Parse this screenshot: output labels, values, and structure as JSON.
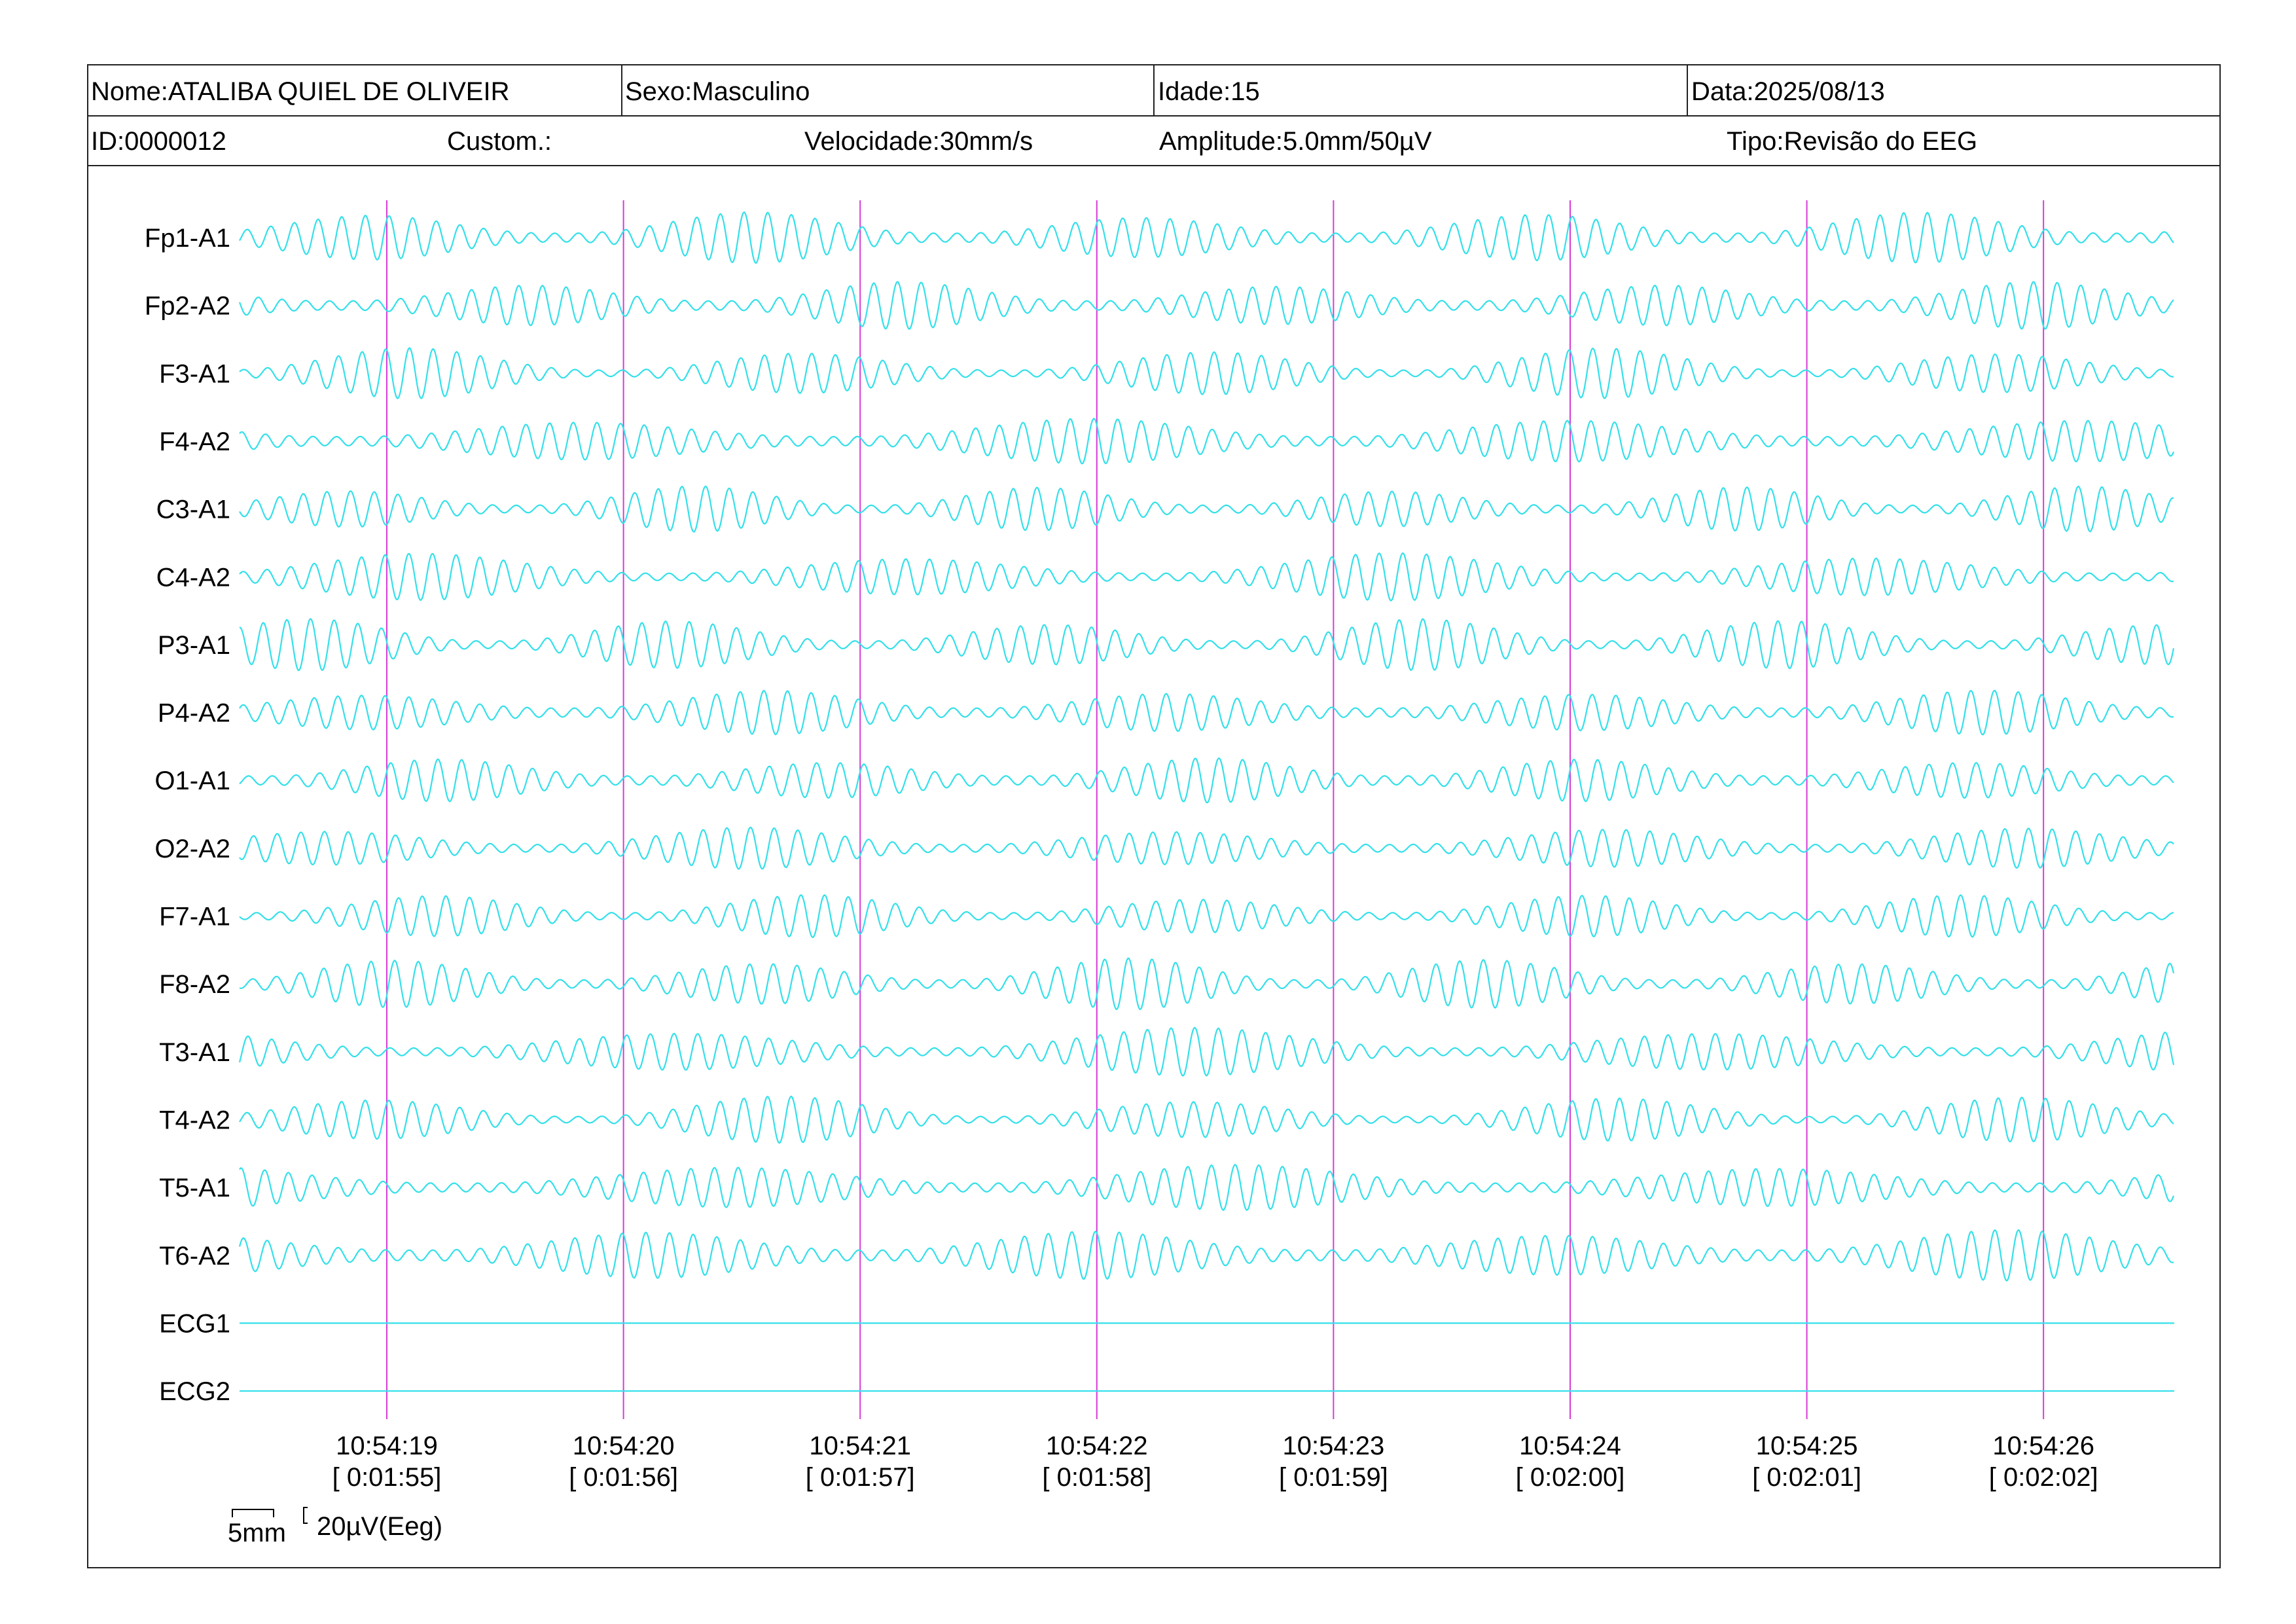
{
  "header": {
    "nome": "Nome:ATALIBA QUIEL DE OLIVEIR",
    "sexo": "Sexo:Masculino",
    "idade": "Idade:15",
    "data": "Data:2025/08/13",
    "id": "ID:0000012",
    "custom": "Custom.:",
    "velocidade": "Velocidade:30mm/s",
    "amplitude": "Amplitude:5.0mm/50µV",
    "tipo": "Tipo:Revisão do EEG"
  },
  "scale": {
    "time_label": "5mm",
    "amplitude_label": "20µV(Eeg)"
  },
  "colors": {
    "trace": "#33e0ea",
    "marker": "#d63ad6",
    "frame": "#222222"
  },
  "chart_data": {
    "type": "line",
    "channels": [
      "Fp1-A1",
      "Fp2-A2",
      "F3-A1",
      "F4-A2",
      "C3-A1",
      "C4-A2",
      "P3-A1",
      "P4-A2",
      "O1-A1",
      "O2-A2",
      "F7-A1",
      "F8-A2",
      "T3-A1",
      "T4-A2",
      "T5-A1",
      "T6-A2",
      "ECG1",
      "ECG2"
    ],
    "time_markers": [
      {
        "clock": "10:54:19",
        "elapsed": "[ 0:01:55]"
      },
      {
        "clock": "10:54:20",
        "elapsed": "[ 0:01:56]"
      },
      {
        "clock": "10:54:21",
        "elapsed": "[ 0:01:57]"
      },
      {
        "clock": "10:54:22",
        "elapsed": "[ 0:01:58]"
      },
      {
        "clock": "10:54:23",
        "elapsed": "[ 0:01:59]"
      },
      {
        "clock": "10:54:24",
        "elapsed": "[ 0:02:00]"
      },
      {
        "clock": "10:54:25",
        "elapsed": "[ 0:02:01]"
      },
      {
        "clock": "10:54:26",
        "elapsed": "[ 0:02:02]"
      }
    ],
    "eeg_frequency_hz": 10,
    "flat_channels": [
      "ECG1",
      "ECG2"
    ]
  }
}
